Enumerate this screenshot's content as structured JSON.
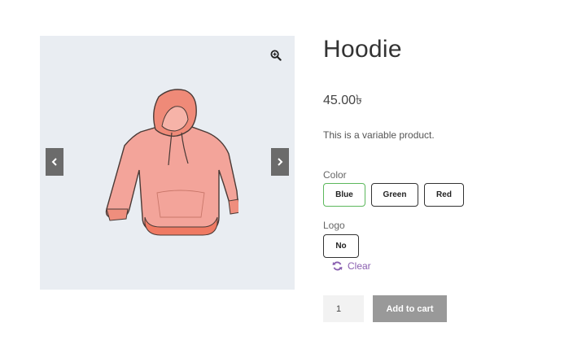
{
  "gallery": {
    "zoom_icon": "zoom-in-icon",
    "prev_icon": "chevron-left-icon",
    "next_icon": "chevron-right-icon",
    "image_alt": "hoodie-illustration"
  },
  "product": {
    "title": "Hoodie",
    "price": "45.00৳",
    "description": "This is a variable product."
  },
  "attributes": {
    "color": {
      "label": "Color",
      "options": [
        "Blue",
        "Green",
        "Red"
      ],
      "selected": "Blue"
    },
    "logo": {
      "label": "Logo",
      "options": [
        "No"
      ]
    }
  },
  "clear": {
    "icon": "refresh-icon",
    "label": "Clear"
  },
  "cart": {
    "quantity": "1",
    "button_label": "Add to cart"
  },
  "colors": {
    "accent_purple": "#8a5fb0",
    "selected_border": "#5cb85c",
    "button_bg": "#999999",
    "gallery_bg": "#e9edf2",
    "hoodie": "#f3a49a"
  }
}
